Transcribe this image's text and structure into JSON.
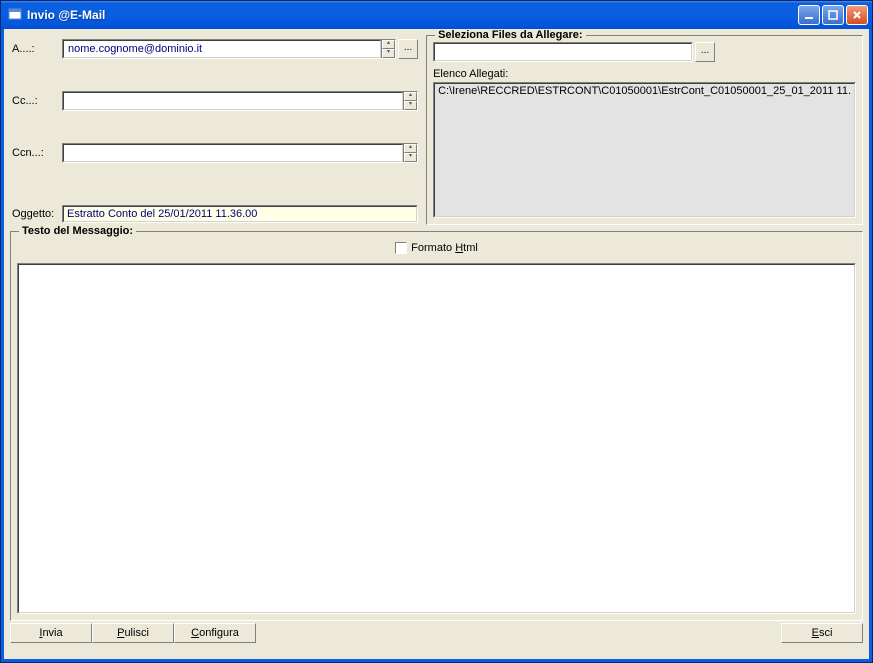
{
  "window": {
    "title": "Invio @E-Mail"
  },
  "fields": {
    "to_label": "A....:",
    "to_value": "nome.cognome@dominio.it",
    "cc_label": "Cc...:",
    "cc_value": "",
    "bcc_label": "Ccn...:",
    "bcc_value": "",
    "subject_label": "Oggetto:",
    "subject_value": "Estratto Conto del 25/01/2011 11.36.00"
  },
  "attach": {
    "group_title": "Seleziona Files da Allegare:",
    "browse_label": "...",
    "list_label": "Elenco Allegati:",
    "items": [
      "C:\\Irene\\RECCRED\\ESTRCONT\\C01050001\\EstrCont_C01050001_25_01_2011 11."
    ]
  },
  "message": {
    "group_title": "Testo del Messaggio:",
    "format_prefix": "Formato ",
    "format_ul": "H",
    "format_suffix": "tml",
    "body": ""
  },
  "buttons": {
    "send_ul": "I",
    "send_rest": "nvia",
    "clear_ul": "P",
    "clear_rest": "ulisci",
    "config_ul": "C",
    "config_rest": "onfigura",
    "exit_ul": "E",
    "exit_rest": "sci",
    "to_browse": "..."
  }
}
